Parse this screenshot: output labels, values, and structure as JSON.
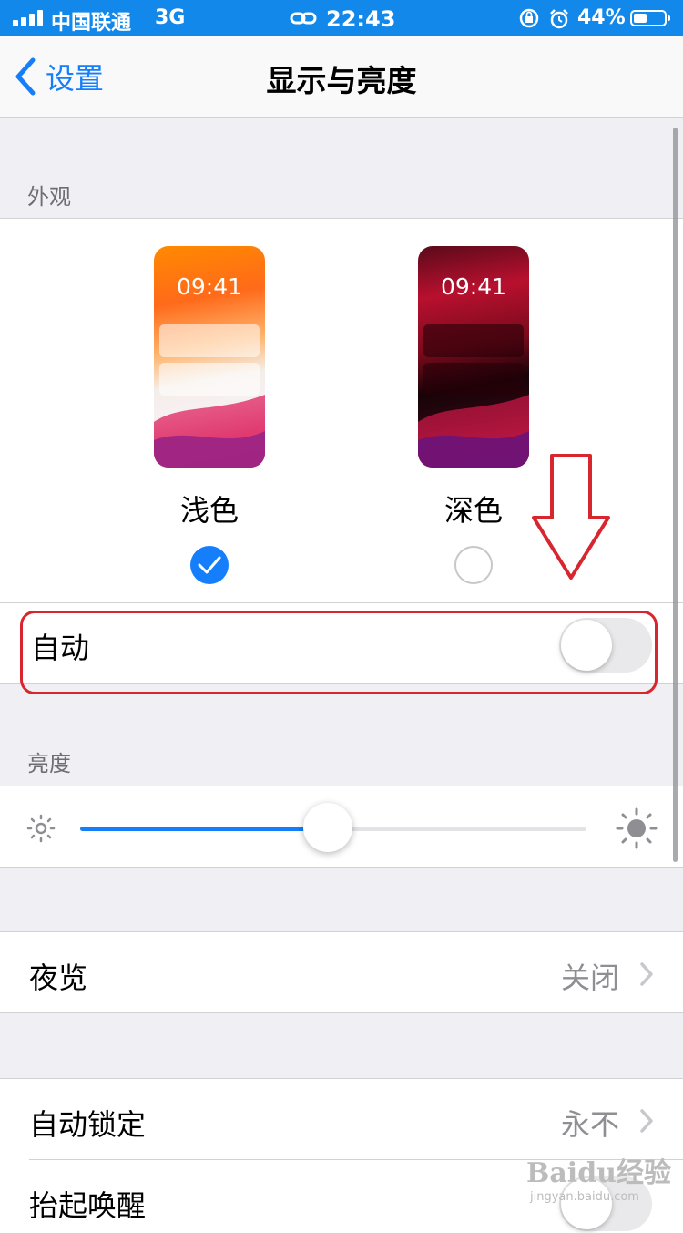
{
  "status_bar": {
    "carrier": "中国联通",
    "network": "3G",
    "time": "22:43",
    "battery_percent": "44%",
    "battery_level": 0.44,
    "color": "#1288ea"
  },
  "nav": {
    "back_label": "设置",
    "title": "显示与亮度",
    "accent": "#147efb"
  },
  "appearance": {
    "header": "外观",
    "options": [
      {
        "label": "浅色",
        "preview_time": "09:41",
        "selected": true
      },
      {
        "label": "深色",
        "preview_time": "09:41",
        "selected": false
      }
    ],
    "auto": {
      "label": "自动",
      "enabled": false
    }
  },
  "brightness": {
    "header": "亮度",
    "level": 0.49
  },
  "rows": {
    "night_shift": {
      "label": "夜览",
      "value": "关闭"
    },
    "auto_lock": {
      "label": "自动锁定",
      "value": "永不"
    },
    "raise_to_wake": {
      "label": "抬起唤醒"
    }
  },
  "annotation": {
    "color": "#d8262f"
  },
  "watermark": {
    "text": "Baidu经验",
    "url_text": "jingyan.baidu.com"
  }
}
